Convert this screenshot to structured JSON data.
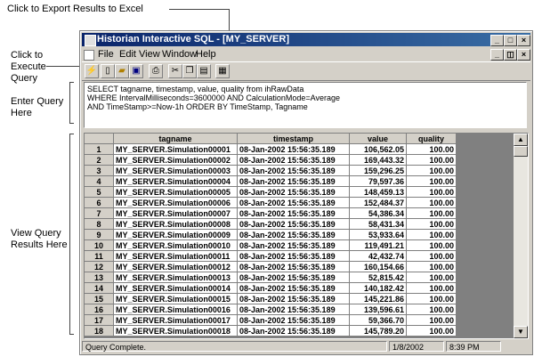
{
  "annotations": {
    "export_excel": "Click to Export Results to Excel",
    "execute_query": [
      "Click to",
      "Execute",
      "Query"
    ],
    "enter_query": [
      "Enter Query",
      "Here"
    ],
    "view_results": [
      "View Query",
      "Results Here"
    ]
  },
  "window": {
    "title": "Historian Interactive SQL - [MY_SERVER]",
    "controls": {
      "minimize": "_",
      "maximize": "□",
      "close": "×"
    },
    "inner_controls": {
      "minimize": "_",
      "restore": "◫",
      "close": "×"
    }
  },
  "menu": [
    "File",
    "Edit",
    "View",
    "Window",
    "Help"
  ],
  "toolbar_icons": [
    "execute-icon",
    "new-icon",
    "open-icon",
    "save-icon",
    "print-icon",
    "cut-icon",
    "copy-icon",
    "paste-icon",
    "excel-export-icon"
  ],
  "query": {
    "lines": [
      "SELECT tagname, timestamp, value, quality from ihRawData",
      "WHERE IntervalMilliseconds=3600000 AND CalculationMode=Average",
      "AND TimeStamp>=Now-1h ORDER BY TimeStamp, Tagname"
    ]
  },
  "results": {
    "columns": [
      "tagname",
      "timestamp",
      "value",
      "quality"
    ],
    "rows": [
      {
        "n": "1",
        "tagname": "MY_SERVER.Simulation00001",
        "timestamp": "08-Jan-2002 15:56:35.189",
        "value": "106,562.05",
        "quality": "100.00"
      },
      {
        "n": "2",
        "tagname": "MY_SERVER.Simulation00002",
        "timestamp": "08-Jan-2002 15:56:35.189",
        "value": "169,443.32",
        "quality": "100.00"
      },
      {
        "n": "3",
        "tagname": "MY_SERVER.Simulation00003",
        "timestamp": "08-Jan-2002 15:56:35.189",
        "value": "159,296.25",
        "quality": "100.00"
      },
      {
        "n": "4",
        "tagname": "MY_SERVER.Simulation00004",
        "timestamp": "08-Jan-2002 15:56:35.189",
        "value": "79,597.36",
        "quality": "100.00"
      },
      {
        "n": "5",
        "tagname": "MY_SERVER.Simulation00005",
        "timestamp": "08-Jan-2002 15:56:35.189",
        "value": "148,459.13",
        "quality": "100.00"
      },
      {
        "n": "6",
        "tagname": "MY_SERVER.Simulation00006",
        "timestamp": "08-Jan-2002 15:56:35.189",
        "value": "152,484.37",
        "quality": "100.00"
      },
      {
        "n": "7",
        "tagname": "MY_SERVER.Simulation00007",
        "timestamp": "08-Jan-2002 15:56:35.189",
        "value": "54,386.34",
        "quality": "100.00"
      },
      {
        "n": "8",
        "tagname": "MY_SERVER.Simulation00008",
        "timestamp": "08-Jan-2002 15:56:35.189",
        "value": "58,431.34",
        "quality": "100.00"
      },
      {
        "n": "9",
        "tagname": "MY_SERVER.Simulation00009",
        "timestamp": "08-Jan-2002 15:56:35.189",
        "value": "53,933.64",
        "quality": "100.00"
      },
      {
        "n": "10",
        "tagname": "MY_SERVER.Simulation00010",
        "timestamp": "08-Jan-2002 15:56:35.189",
        "value": "119,491.21",
        "quality": "100.00"
      },
      {
        "n": "11",
        "tagname": "MY_SERVER.Simulation00011",
        "timestamp": "08-Jan-2002 15:56:35.189",
        "value": "42,432.74",
        "quality": "100.00"
      },
      {
        "n": "12",
        "tagname": "MY_SERVER.Simulation00012",
        "timestamp": "08-Jan-2002 15:56:35.189",
        "value": "160,154.66",
        "quality": "100.00"
      },
      {
        "n": "13",
        "tagname": "MY_SERVER.Simulation00013",
        "timestamp": "08-Jan-2002 15:56:35.189",
        "value": "52,815.42",
        "quality": "100.00"
      },
      {
        "n": "14",
        "tagname": "MY_SERVER.Simulation00014",
        "timestamp": "08-Jan-2002 15:56:35.189",
        "value": "140,182.42",
        "quality": "100.00"
      },
      {
        "n": "15",
        "tagname": "MY_SERVER.Simulation00015",
        "timestamp": "08-Jan-2002 15:56:35.189",
        "value": "145,221.86",
        "quality": "100.00"
      },
      {
        "n": "16",
        "tagname": "MY_SERVER.Simulation00016",
        "timestamp": "08-Jan-2002 15:56:35.189",
        "value": "139,596.61",
        "quality": "100.00"
      },
      {
        "n": "17",
        "tagname": "MY_SERVER.Simulation00017",
        "timestamp": "08-Jan-2002 15:56:35.189",
        "value": "59,366.70",
        "quality": "100.00"
      },
      {
        "n": "18",
        "tagname": "MY_SERVER.Simulation00018",
        "timestamp": "08-Jan-2002 15:56:35.189",
        "value": "145,789.20",
        "quality": "100.00"
      }
    ]
  },
  "status": {
    "message": "Query Complete.",
    "date": "1/8/2002",
    "time": "8:39 PM"
  },
  "colors": {
    "titlebar": "#0a246a",
    "chrome": "#d4d0c8"
  }
}
